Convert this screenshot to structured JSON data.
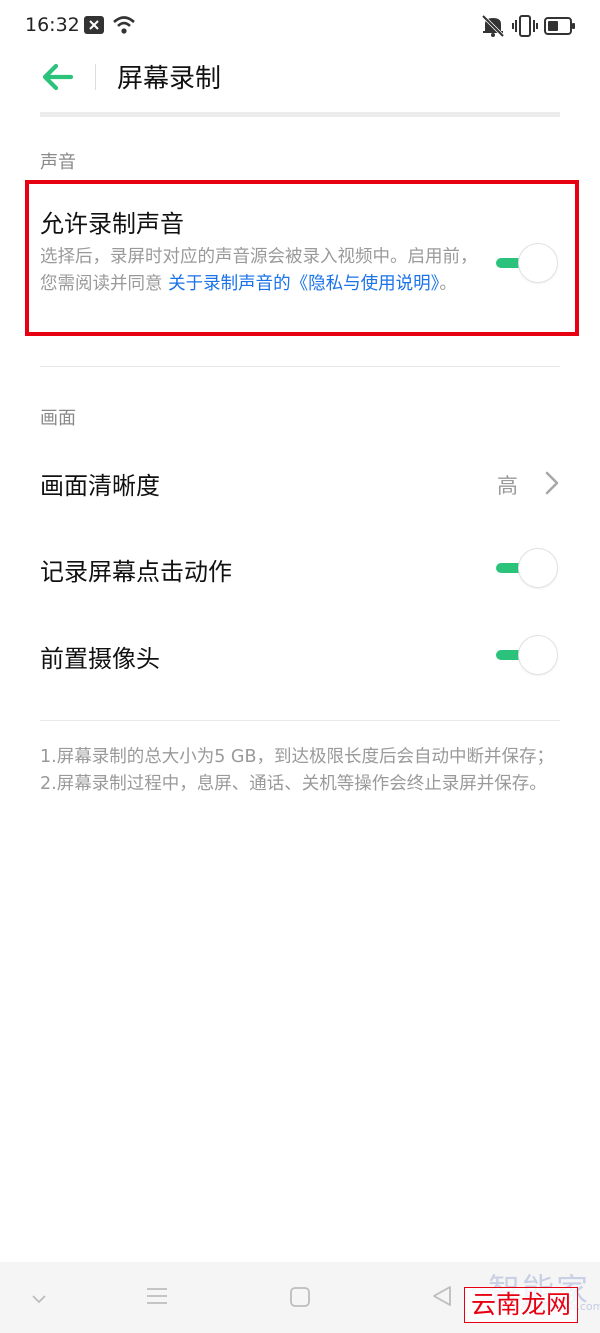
{
  "status": {
    "time": "16:32",
    "icons": [
      "notification-x-icon",
      "wifi-icon",
      "mute-icon",
      "vibrate-icon",
      "battery-icon"
    ]
  },
  "header": {
    "title": "屏幕录制",
    "back_icon": "arrow-left-icon"
  },
  "sound_section": {
    "label": "声音",
    "item": {
      "title": "允许录制声音",
      "description": "选择后，录屏时对应的声音源会被录入视频中。启用前，您需阅读并同意",
      "link_text": "关于录制声音的《隐私与使用说明》",
      "suffix": "。",
      "enabled": true
    }
  },
  "picture_section": {
    "label": "画面",
    "items": [
      {
        "title": "画面清晰度",
        "value": "高"
      },
      {
        "title": "记录屏幕点击动作",
        "enabled": true
      },
      {
        "title": "前置摄像头",
        "enabled": true
      }
    ]
  },
  "notes": {
    "line1": "1.屏幕录制的总大小为5 GB，到达极限长度后会自动中断并保存；",
    "line2": "2.屏幕录制过程中，息屏、通话、关机等操作会终止录屏并保存。"
  },
  "navbar": {
    "icons": [
      "chevron-down-icon",
      "menu-icon",
      "home-icon",
      "back-triangle-icon"
    ]
  },
  "watermarks": {
    "brand": "智能家",
    "site": "zhinengjia.com",
    "badge": "云南龙网"
  },
  "colors": {
    "accent": "#2bc37c",
    "link": "#1a73e8",
    "highlight": "#e60012"
  }
}
